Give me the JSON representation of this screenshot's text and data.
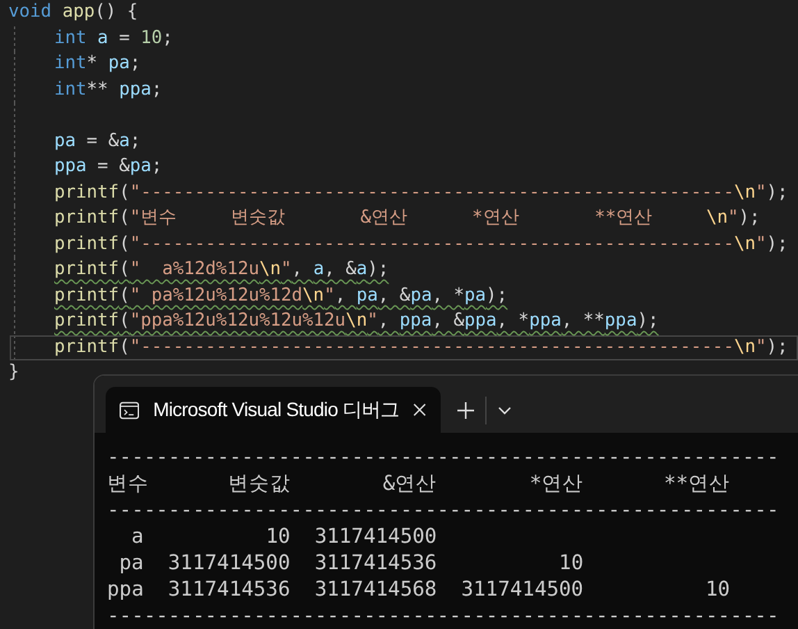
{
  "code": {
    "header": {
      "tokens": [
        {
          "text": "void ",
          "kind": "kw"
        },
        {
          "text": "app",
          "kind": "fn"
        },
        {
          "text": "() {",
          "kind": "p"
        }
      ]
    },
    "body": [
      {
        "kind": "code",
        "warning": false,
        "current": false,
        "tokens": [
          {
            "text": "int ",
            "kind": "kw"
          },
          {
            "text": "a",
            "kind": "var"
          },
          {
            "text": " = ",
            "kind": "p"
          },
          {
            "text": "10",
            "kind": "num"
          },
          {
            "text": ";",
            "kind": "p"
          }
        ]
      },
      {
        "kind": "code",
        "warning": false,
        "current": false,
        "tokens": [
          {
            "text": "int",
            "kind": "kw"
          },
          {
            "text": "* ",
            "kind": "p"
          },
          {
            "text": "pa",
            "kind": "var"
          },
          {
            "text": ";",
            "kind": "p"
          }
        ]
      },
      {
        "kind": "code",
        "warning": false,
        "current": false,
        "tokens": [
          {
            "text": "int",
            "kind": "kw"
          },
          {
            "text": "** ",
            "kind": "p"
          },
          {
            "text": "ppa",
            "kind": "var"
          },
          {
            "text": ";",
            "kind": "p"
          }
        ]
      },
      {
        "kind": "blank"
      },
      {
        "kind": "code",
        "warning": false,
        "current": false,
        "tokens": [
          {
            "text": "pa",
            "kind": "var"
          },
          {
            "text": " = &",
            "kind": "p"
          },
          {
            "text": "a",
            "kind": "var"
          },
          {
            "text": ";",
            "kind": "p"
          }
        ]
      },
      {
        "kind": "code",
        "warning": false,
        "current": false,
        "tokens": [
          {
            "text": "ppa",
            "kind": "var"
          },
          {
            "text": " = &",
            "kind": "p"
          },
          {
            "text": "pa",
            "kind": "var"
          },
          {
            "text": ";",
            "kind": "p"
          }
        ]
      },
      {
        "kind": "code",
        "warning": false,
        "current": false,
        "tokens": [
          {
            "text": "printf",
            "kind": "fn"
          },
          {
            "text": "(",
            "kind": "p"
          },
          {
            "text": "\"-------------------------------------------------------",
            "kind": "str"
          },
          {
            "text": "\\n",
            "kind": "esc"
          },
          {
            "text": "\"",
            "kind": "str"
          },
          {
            "text": ");",
            "kind": "p"
          }
        ]
      },
      {
        "kind": "code",
        "warning": false,
        "current": false,
        "tokens": [
          {
            "text": "printf",
            "kind": "fn"
          },
          {
            "text": "(",
            "kind": "p"
          },
          {
            "text": "\"변수     변숫값       &연산      *연산       **연산     ",
            "kind": "str"
          },
          {
            "text": "\\n",
            "kind": "esc"
          },
          {
            "text": "\"",
            "kind": "str"
          },
          {
            "text": ");",
            "kind": "p"
          }
        ]
      },
      {
        "kind": "code",
        "warning": false,
        "current": false,
        "tokens": [
          {
            "text": "printf",
            "kind": "fn"
          },
          {
            "text": "(",
            "kind": "p"
          },
          {
            "text": "\"-------------------------------------------------------",
            "kind": "str"
          },
          {
            "text": "\\n",
            "kind": "esc"
          },
          {
            "text": "\"",
            "kind": "str"
          },
          {
            "text": ");",
            "kind": "p"
          }
        ]
      },
      {
        "kind": "code",
        "warning": true,
        "current": false,
        "tokens": [
          {
            "text": "printf",
            "kind": "fn"
          },
          {
            "text": "(",
            "kind": "p"
          },
          {
            "text": "\"  a%12d%12u",
            "kind": "str"
          },
          {
            "text": "\\n",
            "kind": "esc"
          },
          {
            "text": "\"",
            "kind": "str"
          },
          {
            "text": ", ",
            "kind": "p"
          },
          {
            "text": "a",
            "kind": "var"
          },
          {
            "text": ", &",
            "kind": "p"
          },
          {
            "text": "a",
            "kind": "var"
          },
          {
            "text": ");",
            "kind": "p"
          }
        ]
      },
      {
        "kind": "code",
        "warning": true,
        "current": false,
        "tokens": [
          {
            "text": "printf",
            "kind": "fn"
          },
          {
            "text": "(",
            "kind": "p"
          },
          {
            "text": "\" pa%12u%12u%12d",
            "kind": "str"
          },
          {
            "text": "\\n",
            "kind": "esc"
          },
          {
            "text": "\"",
            "kind": "str"
          },
          {
            "text": ", ",
            "kind": "p"
          },
          {
            "text": "pa",
            "kind": "var"
          },
          {
            "text": ", &",
            "kind": "p"
          },
          {
            "text": "pa",
            "kind": "var"
          },
          {
            "text": ", *",
            "kind": "p"
          },
          {
            "text": "pa",
            "kind": "var"
          },
          {
            "text": ");",
            "kind": "p"
          }
        ]
      },
      {
        "kind": "code",
        "warning": true,
        "current": false,
        "tokens": [
          {
            "text": "printf",
            "kind": "fn"
          },
          {
            "text": "(",
            "kind": "p"
          },
          {
            "text": "\"ppa%12u%12u%12u%12u",
            "kind": "str"
          },
          {
            "text": "\\n",
            "kind": "esc"
          },
          {
            "text": "\"",
            "kind": "str"
          },
          {
            "text": ", ",
            "kind": "p"
          },
          {
            "text": "ppa",
            "kind": "var"
          },
          {
            "text": ", &",
            "kind": "p"
          },
          {
            "text": "ppa",
            "kind": "var"
          },
          {
            "text": ", *",
            "kind": "p"
          },
          {
            "text": "ppa",
            "kind": "var"
          },
          {
            "text": ", **",
            "kind": "p"
          },
          {
            "text": "ppa",
            "kind": "var"
          },
          {
            "text": ");",
            "kind": "p"
          }
        ]
      },
      {
        "kind": "code",
        "warning": false,
        "current": true,
        "tokens": [
          {
            "text": "printf",
            "kind": "fn"
          },
          {
            "text": "(",
            "kind": "p"
          },
          {
            "text": "\"-------------------------------------------------------",
            "kind": "str"
          },
          {
            "text": "\\n",
            "kind": "esc"
          },
          {
            "text": "\"",
            "kind": "str"
          },
          {
            "text": ");",
            "kind": "p"
          }
        ]
      }
    ],
    "footer": {
      "tokens": [
        {
          "text": "}",
          "kind": "p"
        }
      ]
    }
  },
  "terminal": {
    "tab": {
      "title": "Microsoft Visual Studio 디버그",
      "selected": true
    },
    "output": [
      {
        "kind": "rule",
        "text": "-------------------------------------------------------"
      },
      {
        "kind": "header",
        "cells": [
          "변수",
          "변숫값",
          "&연산",
          "*연산",
          "**연산"
        ]
      },
      {
        "kind": "rule",
        "text": "-------------------------------------------------------"
      },
      {
        "kind": "row",
        "cells": [
          "a",
          "10",
          "3117414500"
        ]
      },
      {
        "kind": "row",
        "cells": [
          "pa",
          "3117414500",
          "3117414536",
          "10"
        ]
      },
      {
        "kind": "row",
        "cells": [
          "ppa",
          "3117414536",
          "3117414568",
          "3117414500",
          "10"
        ]
      },
      {
        "kind": "rule",
        "text": "-------------------------------------------------------"
      }
    ]
  }
}
